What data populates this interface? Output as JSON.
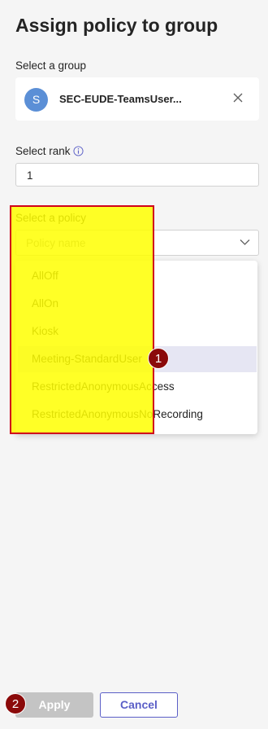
{
  "page": {
    "title": "Assign policy to group"
  },
  "group": {
    "label": "Select a group",
    "avatar_initial": "S",
    "selected_name": "SEC-EUDE-TeamsUser...",
    "avatar_color": "#5b8fd6",
    "remove_icon": "close-icon"
  },
  "rank": {
    "label": "Select rank",
    "value": "1",
    "info_icon": "info-icon"
  },
  "policy": {
    "label": "Select a policy",
    "placeholder": "Policy name",
    "options": [
      {
        "label": "AllOff"
      },
      {
        "label": "AllOn"
      },
      {
        "label": "Kiosk"
      },
      {
        "label": "Meeting-StandardUser",
        "highlighted": true
      },
      {
        "label": "RestrictedAnonymousAccess"
      },
      {
        "label": "RestrictedAnonymousNoRecording"
      }
    ]
  },
  "annotations": {
    "step1": "1",
    "step2": "2",
    "highlight_color": "#ffff00",
    "border_color": "#d0021b",
    "badge_color": "#8b0a0a"
  },
  "buttons": {
    "apply_label": "Apply",
    "cancel_label": "Cancel",
    "accent_color": "#5b5fc7"
  }
}
